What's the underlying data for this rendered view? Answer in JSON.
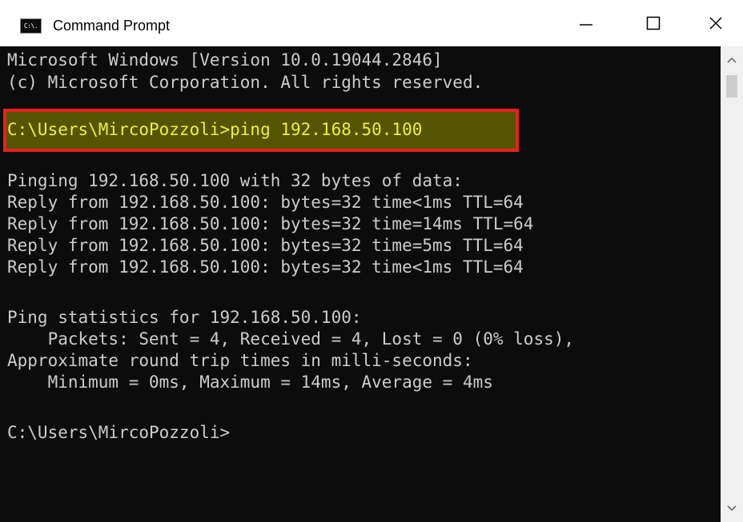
{
  "window": {
    "title": "Command Prompt",
    "icon_text": "C:\\."
  },
  "terminal": {
    "lines": [
      "Microsoft Windows [Version 10.0.19044.2846]",
      "(c) Microsoft Corporation. All rights reserved.",
      "",
      "C:\\Users\\MircoPozzoli>ping 192.168.50.100",
      "",
      "Pinging 192.168.50.100 with 32 bytes of data:",
      "Reply from 192.168.50.100: bytes=32 time<1ms TTL=64",
      "Reply from 192.168.50.100: bytes=32 time=14ms TTL=64",
      "Reply from 192.168.50.100: bytes=32 time=5ms TTL=64",
      "Reply from 192.168.50.100: bytes=32 time<1ms TTL=64",
      "",
      "Ping statistics for 192.168.50.100:",
      "    Packets: Sent = 4, Received = 4, Lost = 0 (0% loss),",
      "Approximate round trip times in milli-seconds:",
      "    Minimum = 0ms, Maximum = 14ms, Average = 4ms",
      "",
      "C:\\Users\\MircoPozzoli>"
    ]
  },
  "colors": {
    "terminal_bg": "#0c0c0c",
    "terminal_text": "#cccccc",
    "highlight_border": "#e8201e",
    "highlight_fill": "#555500",
    "highlight_text": "#eeee44"
  },
  "icons": {
    "minimize": "minimize-icon",
    "maximize": "maximize-icon",
    "close": "close-icon",
    "scroll_up": "chevron-up-icon",
    "scroll_down": "chevron-down-icon"
  }
}
